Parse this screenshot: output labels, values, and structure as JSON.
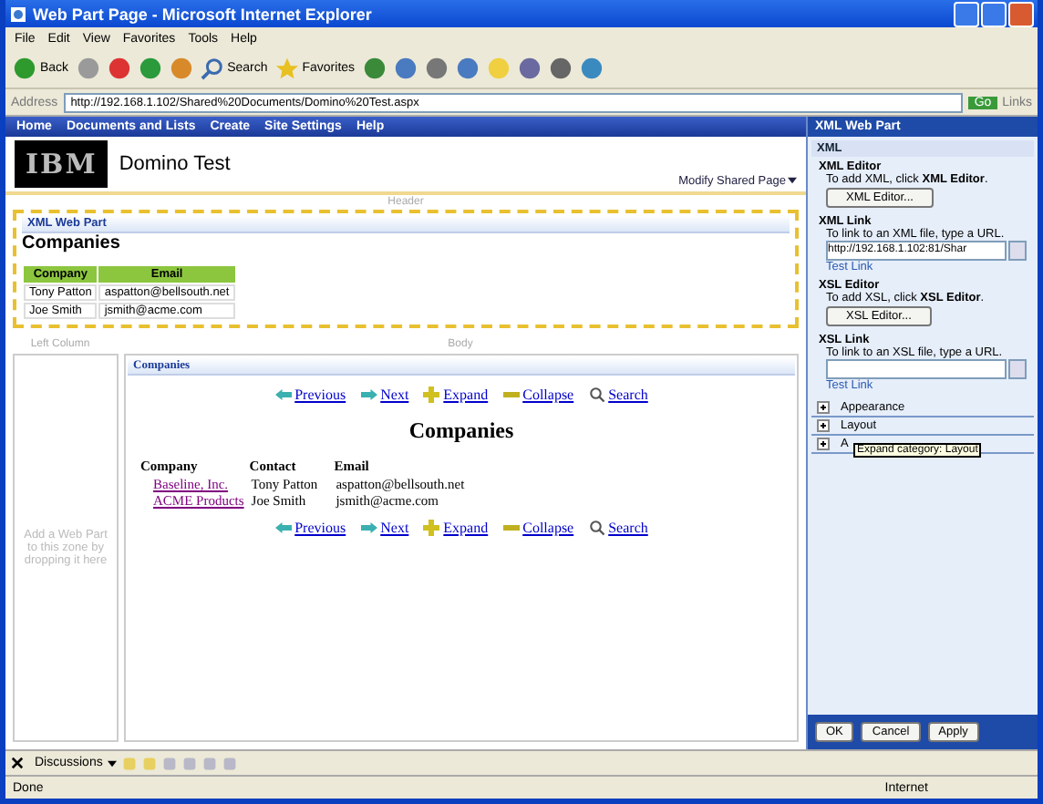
{
  "window": {
    "title": "Web Part Page - Microsoft Internet Explorer"
  },
  "menu": [
    "File",
    "Edit",
    "View",
    "Favorites",
    "Tools",
    "Help"
  ],
  "toolbar": [
    {
      "kind": "back",
      "label": "Back"
    },
    {
      "kind": "forward"
    },
    {
      "kind": "stop"
    },
    {
      "kind": "refresh"
    },
    {
      "kind": "home"
    },
    {
      "kind": "search",
      "label": "Search"
    },
    {
      "kind": "favorites",
      "label": "Favorites"
    },
    {
      "kind": "history"
    },
    {
      "kind": "mail"
    },
    {
      "kind": "print"
    },
    {
      "kind": "edit"
    },
    {
      "kind": "note"
    },
    {
      "kind": "research"
    },
    {
      "kind": "messenger"
    },
    {
      "kind": "network"
    }
  ],
  "address": {
    "label": "Address",
    "value": "http://192.168.1.102/Shared%20Documents/Domino%20Test.aspx",
    "go": "Go",
    "links": "Links"
  },
  "site_nav": [
    "Home",
    "Documents and Lists",
    "Create",
    "Site Settings",
    "Help"
  ],
  "site_header": {
    "logo": "IBM",
    "title": "Domino Test",
    "modify": "Modify Shared Page"
  },
  "zones": {
    "header": "Header",
    "left": "Left Column",
    "body": "Body",
    "left_hint": "Add a Web Part to this zone by dropping it here"
  },
  "xml_web_part": {
    "title": "XML Web Part",
    "heading": "Companies",
    "columns": [
      "Company",
      "Email"
    ],
    "rows": [
      [
        "Tony Patton",
        "aspatton@bellsouth.net"
      ],
      [
        "Joe Smith",
        "jsmith@acme.com"
      ]
    ]
  },
  "companies_part": {
    "title": "Companies",
    "heading": "Companies",
    "nav_top": [
      {
        "kind": "previous",
        "label": "Previous"
      },
      {
        "kind": "next",
        "label": "Next"
      },
      {
        "kind": "expand",
        "label": "Expand"
      },
      {
        "kind": "collapse",
        "label": "Collapse"
      },
      {
        "kind": "search",
        "label": "Search"
      }
    ],
    "columns": [
      "Company",
      "Contact",
      "Email"
    ],
    "rows": [
      [
        "Baseline, Inc.",
        "Tony Patton",
        "aspatton@bellsouth.net"
      ],
      [
        "ACME Products",
        "Joe Smith",
        "jsmith@acme.com"
      ]
    ],
    "nav_bottom": [
      {
        "kind": "previous",
        "label": "Previous"
      },
      {
        "kind": "next",
        "label": "Next"
      },
      {
        "kind": "expand",
        "label": "Expand"
      },
      {
        "kind": "collapse",
        "label": "Collapse"
      },
      {
        "kind": "search",
        "label": "Search"
      }
    ]
  },
  "tool_pane": {
    "title": "XML Web Part",
    "section": "XML",
    "fields": [
      {
        "kind": "editor",
        "heading": "XML Editor",
        "hint": "To add XML, click **XML Editor**.",
        "button": "XML Editor..."
      },
      {
        "kind": "link",
        "heading": "XML Link",
        "hint": "To link to an XML file, type a URL.",
        "value": "http://192.168.1.102:81/Shar",
        "test": "Test Link"
      },
      {
        "kind": "editor",
        "heading": "XSL Editor",
        "hint": "To add XSL, click **XSL Editor**.",
        "button": "XSL Editor..."
      },
      {
        "kind": "link",
        "heading": "XSL Link",
        "hint": "To link to an XSL file, type a URL.",
        "test": "Test Link"
      }
    ],
    "categories": [
      {
        "label": "Appearance",
        "expanded": false
      },
      {
        "label": "Layout",
        "expanded": false
      },
      {
        "label": "A",
        "expanded": false
      }
    ],
    "tooltip": "Expand category: Layout",
    "buttons": [
      "OK",
      "Cancel",
      "Apply"
    ]
  },
  "discussions": "Discussions",
  "status": {
    "text": "Done",
    "zone": "Internet"
  }
}
